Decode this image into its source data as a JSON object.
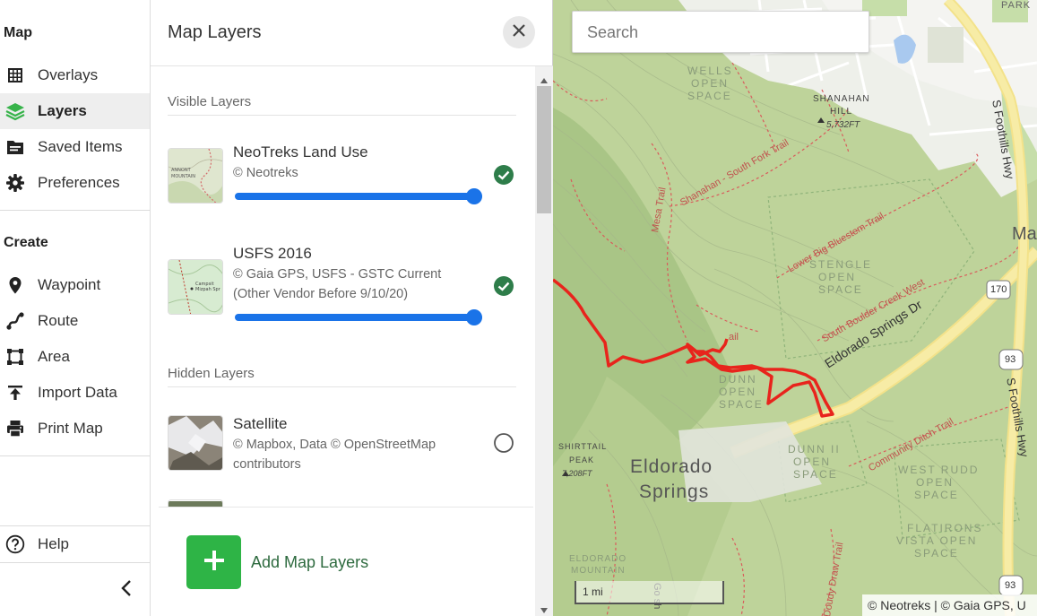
{
  "nav": {
    "map_heading": "Map",
    "map_items": [
      {
        "label": "Overlays",
        "icon": "grid-icon"
      },
      {
        "label": "Layers",
        "icon": "layers-icon"
      },
      {
        "label": "Saved Items",
        "icon": "folder-icon"
      },
      {
        "label": "Preferences",
        "icon": "gear-icon"
      }
    ],
    "create_heading": "Create",
    "create_items": [
      {
        "label": "Waypoint",
        "icon": "pin-icon"
      },
      {
        "label": "Route",
        "icon": "route-icon"
      },
      {
        "label": "Area",
        "icon": "area-icon"
      },
      {
        "label": "Import Data",
        "icon": "upload-icon"
      },
      {
        "label": "Print Map",
        "icon": "printer-icon"
      }
    ],
    "help_label": "Help",
    "active_item": "Layers"
  },
  "panel": {
    "title": "Map Layers",
    "visible_heading": "Visible Layers",
    "visible_layers": [
      {
        "name": "NeoTreks Land Use",
        "source": "© Neotreks",
        "source_line2": "",
        "opacity": 1.0,
        "checked": true
      },
      {
        "name": "USFS 2016",
        "source": "© Gaia GPS, USFS - GSTC Current",
        "source_line2": "(Other Vendor Before 9/10/20)",
        "opacity": 1.0,
        "checked": true
      }
    ],
    "hidden_heading": "Hidden Layers",
    "hidden_layers": [
      {
        "name": "Satellite",
        "source": "© Mapbox, Data © OpenStreetMap",
        "source_line2": "contributors",
        "checked": false
      }
    ],
    "add_button_label": "Add Map Layers"
  },
  "map": {
    "search_placeholder": "Search",
    "scale_label": "1 mi",
    "attribution": "© Neotreks | © Gaia GPS, U",
    "labels": {
      "wells": "WELLS",
      "open": "OPEN",
      "space": "SPACE",
      "shanahan": "SHANAHAN",
      "hill": "HILL",
      "hill_elev": "5,732FT",
      "stengle": "STENGLE",
      "dunn": "DUNN",
      "dunn2": "DUNN II",
      "west_rudd": "WEST RUDD",
      "flatirons": "FLATIRONS",
      "vista_open": "VISTA OPEN",
      "eldorado": "Eldorado",
      "springs": "Springs",
      "eldorado_mtn": "ELDORADO",
      "mountain": "MOUNTAIN",
      "shirttail": "SHIRTTAIL",
      "peak": "PEAK",
      "peak_elev": "7,208FT",
      "park": "PARK",
      "ma": "Ma",
      "eldorado_springs_dr": "Eldorado Springs Dr",
      "s_foothills_hwy": "S Foothills Hwy",
      "shanahan_south_fork": "Shanahan - South Fork Trail",
      "mesa_trail": "Mesa Trail",
      "lower_big_bluestem": "Lower Big Bluestem Trail",
      "south_boulder_creek": "South Boulder Creek West",
      "community_ditch": "Community Ditch Trail",
      "doudy_draw": "Doudy Draw Trail",
      "trail_fragment": "ail",
      "go_sh": "Go sh",
      "route_170": "170",
      "route_93": "93"
    }
  }
}
